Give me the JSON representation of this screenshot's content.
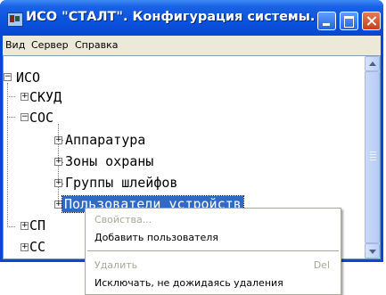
{
  "window": {
    "title": "ИСО \"СТАЛТ\". Конфигурация системы."
  },
  "menubar": {
    "items": [
      "Вид",
      "Сервер",
      "Справка"
    ]
  },
  "tree": {
    "nodes": [
      {
        "label": "ИСО",
        "expander": "−"
      },
      {
        "label": "СКУД",
        "expander": "+"
      },
      {
        "label": "СОС",
        "expander": "−"
      },
      {
        "label": "Аппаратура",
        "expander": "+"
      },
      {
        "label": "Зоны охраны",
        "expander": "+"
      },
      {
        "label": "Группы шлейфов",
        "expander": "+"
      },
      {
        "label": "Пользователи устройств",
        "expander": "+",
        "selected": true
      },
      {
        "label": "СП",
        "expander": "+"
      },
      {
        "label": "СС",
        "expander": "+"
      }
    ]
  },
  "context_menu": {
    "items": [
      {
        "label": "Свойства...",
        "disabled": true
      },
      {
        "label": "Добавить пользователя",
        "disabled": false
      },
      {
        "label": "Удалить",
        "shortcut": "Del",
        "disabled": true
      },
      {
        "label": "Исключать, не дожидаясь удаления",
        "disabled": false
      }
    ]
  },
  "colors": {
    "titlebar": "#0a55de",
    "selection": "#316ac5",
    "menu_bg": "#ece9d8"
  }
}
